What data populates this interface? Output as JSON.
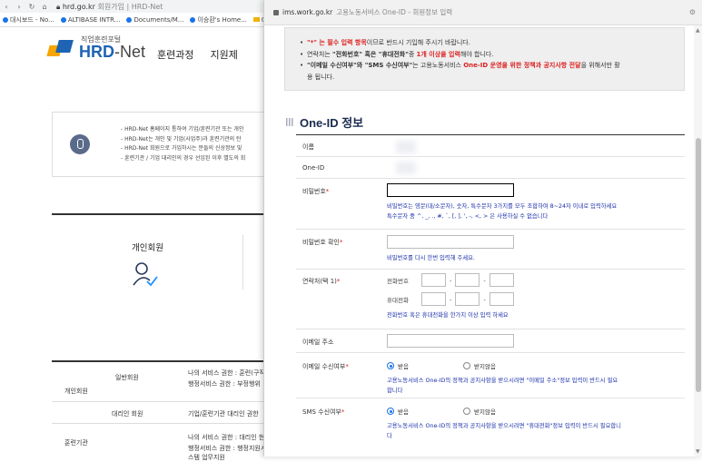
{
  "browser": {
    "url_domain": "hrd.go.kr",
    "url_title": "회원가입 | HRD-Net",
    "bookmarks": [
      {
        "label": "대시보드 - No...",
        "kind": "dot"
      },
      {
        "label": "ALTIBASE INTR...",
        "kind": "dot"
      },
      {
        "label": "Documents/M...",
        "kind": "dot"
      },
      {
        "label": "이승환's Home...",
        "kind": "dot"
      },
      {
        "label": "Ch",
        "kind": "folder"
      }
    ]
  },
  "site": {
    "logo_small": "직업훈련포털",
    "logo_hrd": "HRD",
    "logo_net": "-Net",
    "gnb": [
      "훈련과정",
      "지원제"
    ],
    "notice_lines": [
      "- HRD-Net 홈페이지 통하여 기업/훈련기관 또는 개인",
      "- HRD-Net는 개인 및 기업(사업주)과 훈련기관의 탄",
      "- HRD-Net 회원으로 가입하시는 분들의 신상정보 및",
      "- 훈련기관 / 기업 대리인의 경우 선임된 이후 별도의 회"
    ],
    "member_title": "개인회원",
    "table": [
      {
        "group": "개인회원",
        "type": "일반회원",
        "desc1": "나의 서비스 권한 : 훈련(구직",
        "desc2": "행정서비스 권한 : 부정행위"
      },
      {
        "group": "",
        "type": "대리인 회원",
        "desc1": "기업/훈련기관 대리인 권한",
        "desc2": ""
      },
      {
        "group": "훈련기관",
        "type": "",
        "desc1": "나의 서비스 권한 : 대리인 현",
        "desc2": "행정서비스 권한 : 행정지원시스템 업무지원"
      }
    ]
  },
  "popup": {
    "url_domain": "ims.work.go.kr",
    "url_title": "고용노동서비스 One-ID - 회원정보 입력",
    "info": {
      "line1_red": "\"*\" 는 필수 입력 항목",
      "line1_rest": "이므로 반드시 기입해 주시기 바랍니다.",
      "line2_a": "연락처는 ",
      "line2_b": "\"전화번호\" 혹은 \"휴대전화\"",
      "line2_c": "중 ",
      "line2_d": "1개 이상을 입력",
      "line2_e": "해야 합니다.",
      "line3_a": "\"이메일 수신여부\"와 \"SMS 수신여부\"",
      "line3_b": "는 고용노동서비스 ",
      "line3_c": "One-ID 운영을 위한 정책과 공지사항 전달",
      "line3_d": "을 위해서만 활",
      "line3_e": "용 됩니다."
    },
    "section_title": "One-ID 정보",
    "fields": {
      "name_label": "이름",
      "id_label": "One-ID",
      "pw_label": "비밀번호",
      "pw_help1": "비밀번호는 영문(대/소문자), 숫자, 특수문자 3가지를 모두 조합하여 8~24자 이내로 입력하세요",
      "pw_help2": "특수문자 중 ^, _, ., #, `, [, ], ', -, <, > 은 사용하실 수 없습니다",
      "pw2_label": "비밀번호 확인",
      "pw2_help": "비밀번호를 다시 한번 입력해 주세요.",
      "contact_label": "연락처(택 1)",
      "tel_label": "전화번호",
      "mobile_label": "휴대전화",
      "contact_help": "전화번호 혹은 휴대전화을 한가지 이상 입력 하세요",
      "email_label": "이메일 주소",
      "email_recv_label": "이메일 수신여부",
      "recv_yes": "받음",
      "recv_no": "받지않음",
      "email_help1": "고용노동서비스 One-ID의 정책과 공지사항을 받으시려면 \"이메일 주소\"정보 입력이 반드시 필요",
      "email_help2": "합니다",
      "sms_label": "SMS 수신여부",
      "sms_help1": "고용노동서비스 One-ID의 정책과 공지사항을 받으시려면 \"휴대전화\"정보 입력이 반드시 필요합니",
      "sms_help2": "다",
      "required_mark": "*",
      "dash": "-"
    }
  },
  "colors": {
    "accent_blue": "#1a2fa8",
    "required_red": "#d22222",
    "logo_blue": "#1e63b4",
    "logo_orange": "#f7a600"
  }
}
